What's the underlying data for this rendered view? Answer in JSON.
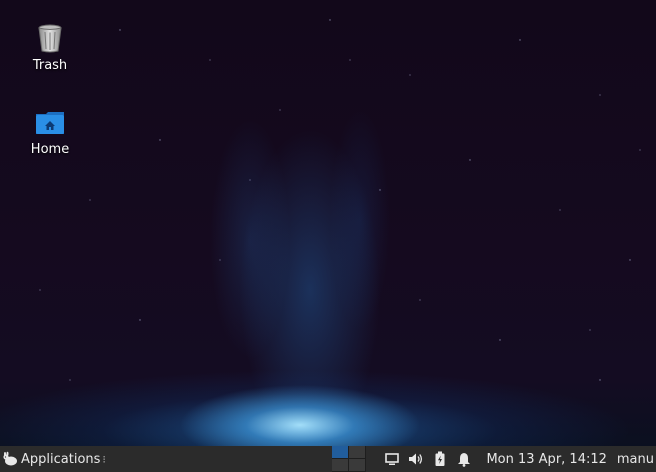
{
  "desktop": {
    "icons": [
      {
        "label": "Trash",
        "icon": "trash-icon"
      },
      {
        "label": "Home",
        "icon": "home-folder-icon"
      }
    ]
  },
  "panel": {
    "applications_label": "Applications",
    "workspaces": {
      "count": 4,
      "active": 1
    },
    "tray": [
      "display-icon",
      "volume-icon",
      "battery-icon",
      "notification-bell-icon"
    ],
    "clock": "Mon 13 Apr, 14:12",
    "user": "manu"
  },
  "colors": {
    "panel_bg": "#2b2b2b",
    "workspace_active": "#215d9c",
    "home_folder": "#2a8fe6"
  }
}
